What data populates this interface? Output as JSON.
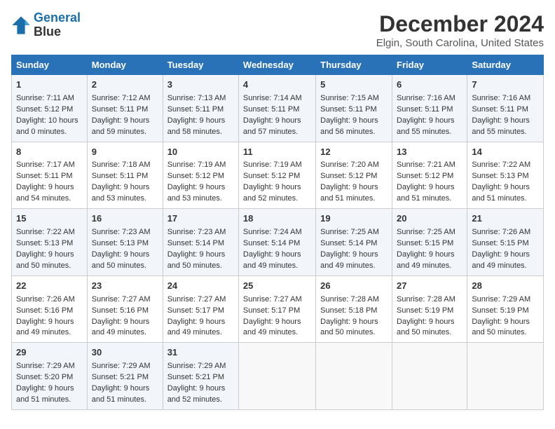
{
  "logo": {
    "line1": "General",
    "line2": "Blue"
  },
  "title": "December 2024",
  "subtitle": "Elgin, South Carolina, United States",
  "days_of_week": [
    "Sunday",
    "Monday",
    "Tuesday",
    "Wednesday",
    "Thursday",
    "Friday",
    "Saturday"
  ],
  "weeks": [
    [
      {
        "day": "1",
        "sunrise": "Sunrise: 7:11 AM",
        "sunset": "Sunset: 5:12 PM",
        "daylight": "Daylight: 10 hours and 0 minutes."
      },
      {
        "day": "2",
        "sunrise": "Sunrise: 7:12 AM",
        "sunset": "Sunset: 5:11 PM",
        "daylight": "Daylight: 9 hours and 59 minutes."
      },
      {
        "day": "3",
        "sunrise": "Sunrise: 7:13 AM",
        "sunset": "Sunset: 5:11 PM",
        "daylight": "Daylight: 9 hours and 58 minutes."
      },
      {
        "day": "4",
        "sunrise": "Sunrise: 7:14 AM",
        "sunset": "Sunset: 5:11 PM",
        "daylight": "Daylight: 9 hours and 57 minutes."
      },
      {
        "day": "5",
        "sunrise": "Sunrise: 7:15 AM",
        "sunset": "Sunset: 5:11 PM",
        "daylight": "Daylight: 9 hours and 56 minutes."
      },
      {
        "day": "6",
        "sunrise": "Sunrise: 7:16 AM",
        "sunset": "Sunset: 5:11 PM",
        "daylight": "Daylight: 9 hours and 55 minutes."
      },
      {
        "day": "7",
        "sunrise": "Sunrise: 7:16 AM",
        "sunset": "Sunset: 5:11 PM",
        "daylight": "Daylight: 9 hours and 55 minutes."
      }
    ],
    [
      {
        "day": "8",
        "sunrise": "Sunrise: 7:17 AM",
        "sunset": "Sunset: 5:11 PM",
        "daylight": "Daylight: 9 hours and 54 minutes."
      },
      {
        "day": "9",
        "sunrise": "Sunrise: 7:18 AM",
        "sunset": "Sunset: 5:11 PM",
        "daylight": "Daylight: 9 hours and 53 minutes."
      },
      {
        "day": "10",
        "sunrise": "Sunrise: 7:19 AM",
        "sunset": "Sunset: 5:12 PM",
        "daylight": "Daylight: 9 hours and 53 minutes."
      },
      {
        "day": "11",
        "sunrise": "Sunrise: 7:19 AM",
        "sunset": "Sunset: 5:12 PM",
        "daylight": "Daylight: 9 hours and 52 minutes."
      },
      {
        "day": "12",
        "sunrise": "Sunrise: 7:20 AM",
        "sunset": "Sunset: 5:12 PM",
        "daylight": "Daylight: 9 hours and 51 minutes."
      },
      {
        "day": "13",
        "sunrise": "Sunrise: 7:21 AM",
        "sunset": "Sunset: 5:12 PM",
        "daylight": "Daylight: 9 hours and 51 minutes."
      },
      {
        "day": "14",
        "sunrise": "Sunrise: 7:22 AM",
        "sunset": "Sunset: 5:13 PM",
        "daylight": "Daylight: 9 hours and 51 minutes."
      }
    ],
    [
      {
        "day": "15",
        "sunrise": "Sunrise: 7:22 AM",
        "sunset": "Sunset: 5:13 PM",
        "daylight": "Daylight: 9 hours and 50 minutes."
      },
      {
        "day": "16",
        "sunrise": "Sunrise: 7:23 AM",
        "sunset": "Sunset: 5:13 PM",
        "daylight": "Daylight: 9 hours and 50 minutes."
      },
      {
        "day": "17",
        "sunrise": "Sunrise: 7:23 AM",
        "sunset": "Sunset: 5:14 PM",
        "daylight": "Daylight: 9 hours and 50 minutes."
      },
      {
        "day": "18",
        "sunrise": "Sunrise: 7:24 AM",
        "sunset": "Sunset: 5:14 PM",
        "daylight": "Daylight: 9 hours and 49 minutes."
      },
      {
        "day": "19",
        "sunrise": "Sunrise: 7:25 AM",
        "sunset": "Sunset: 5:14 PM",
        "daylight": "Daylight: 9 hours and 49 minutes."
      },
      {
        "day": "20",
        "sunrise": "Sunrise: 7:25 AM",
        "sunset": "Sunset: 5:15 PM",
        "daylight": "Daylight: 9 hours and 49 minutes."
      },
      {
        "day": "21",
        "sunrise": "Sunrise: 7:26 AM",
        "sunset": "Sunset: 5:15 PM",
        "daylight": "Daylight: 9 hours and 49 minutes."
      }
    ],
    [
      {
        "day": "22",
        "sunrise": "Sunrise: 7:26 AM",
        "sunset": "Sunset: 5:16 PM",
        "daylight": "Daylight: 9 hours and 49 minutes."
      },
      {
        "day": "23",
        "sunrise": "Sunrise: 7:27 AM",
        "sunset": "Sunset: 5:16 PM",
        "daylight": "Daylight: 9 hours and 49 minutes."
      },
      {
        "day": "24",
        "sunrise": "Sunrise: 7:27 AM",
        "sunset": "Sunset: 5:17 PM",
        "daylight": "Daylight: 9 hours and 49 minutes."
      },
      {
        "day": "25",
        "sunrise": "Sunrise: 7:27 AM",
        "sunset": "Sunset: 5:17 PM",
        "daylight": "Daylight: 9 hours and 49 minutes."
      },
      {
        "day": "26",
        "sunrise": "Sunrise: 7:28 AM",
        "sunset": "Sunset: 5:18 PM",
        "daylight": "Daylight: 9 hours and 50 minutes."
      },
      {
        "day": "27",
        "sunrise": "Sunrise: 7:28 AM",
        "sunset": "Sunset: 5:19 PM",
        "daylight": "Daylight: 9 hours and 50 minutes."
      },
      {
        "day": "28",
        "sunrise": "Sunrise: 7:29 AM",
        "sunset": "Sunset: 5:19 PM",
        "daylight": "Daylight: 9 hours and 50 minutes."
      }
    ],
    [
      {
        "day": "29",
        "sunrise": "Sunrise: 7:29 AM",
        "sunset": "Sunset: 5:20 PM",
        "daylight": "Daylight: 9 hours and 51 minutes."
      },
      {
        "day": "30",
        "sunrise": "Sunrise: 7:29 AM",
        "sunset": "Sunset: 5:21 PM",
        "daylight": "Daylight: 9 hours and 51 minutes."
      },
      {
        "day": "31",
        "sunrise": "Sunrise: 7:29 AM",
        "sunset": "Sunset: 5:21 PM",
        "daylight": "Daylight: 9 hours and 52 minutes."
      },
      {
        "day": "",
        "sunrise": "",
        "sunset": "",
        "daylight": ""
      },
      {
        "day": "",
        "sunrise": "",
        "sunset": "",
        "daylight": ""
      },
      {
        "day": "",
        "sunrise": "",
        "sunset": "",
        "daylight": ""
      },
      {
        "day": "",
        "sunrise": "",
        "sunset": "",
        "daylight": ""
      }
    ]
  ]
}
